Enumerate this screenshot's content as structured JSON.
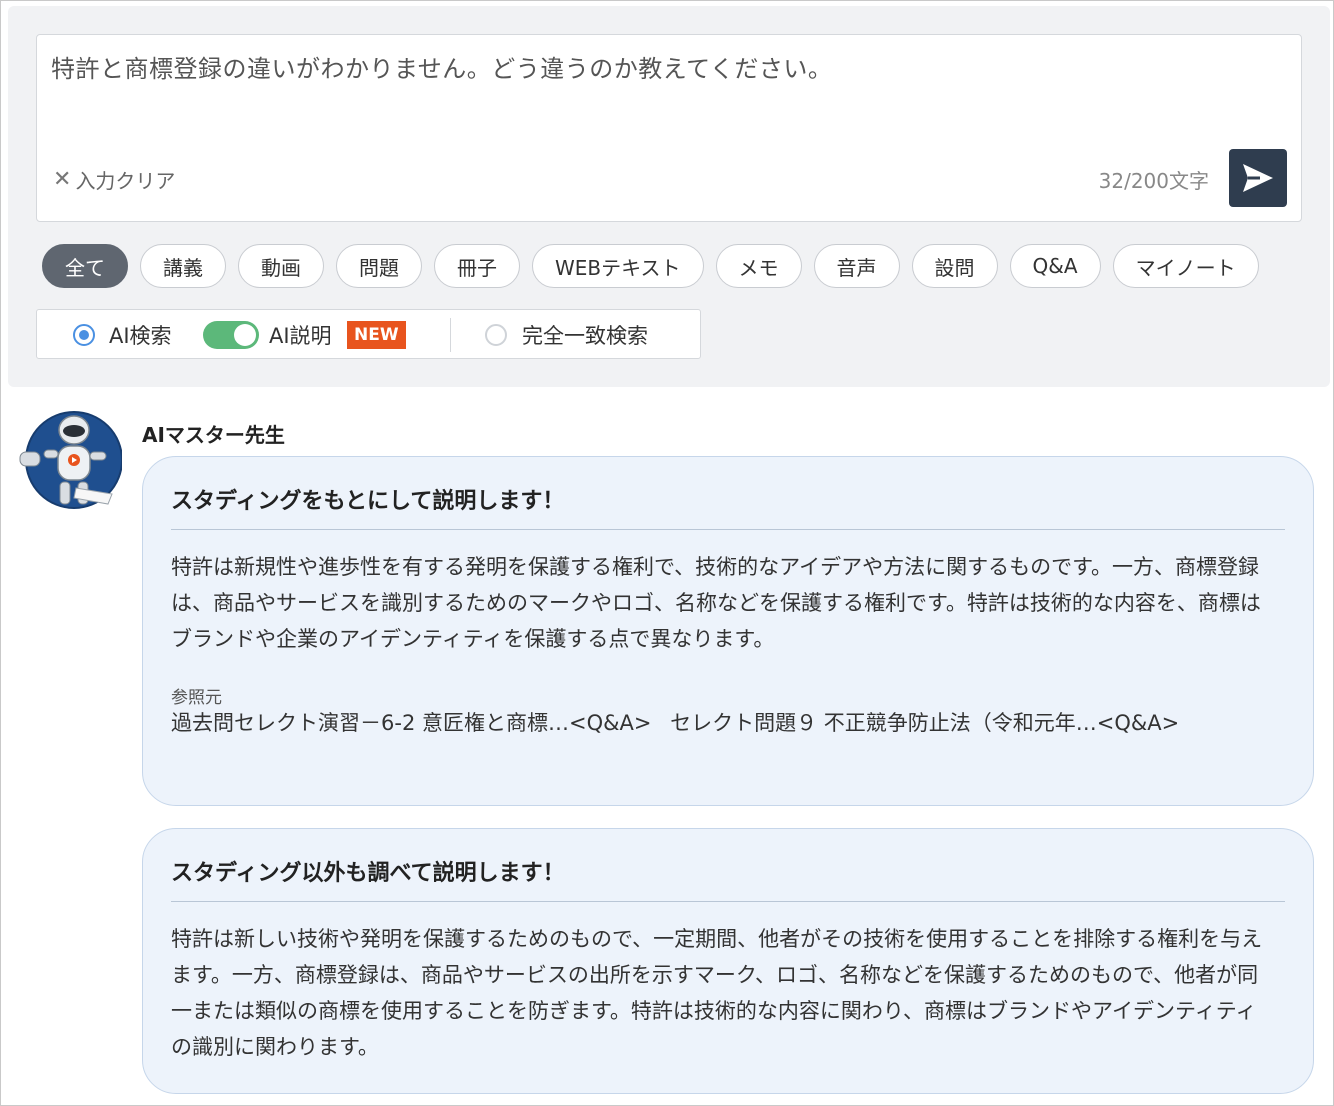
{
  "search": {
    "query": "特許と商標登録の違いがわかりません。どう違うのか教えてください。",
    "clear_label": "入力クリア",
    "char_count": "32/200文字"
  },
  "filters": [
    {
      "label": "全て",
      "active": true
    },
    {
      "label": "講義",
      "active": false
    },
    {
      "label": "動画",
      "active": false
    },
    {
      "label": "問題",
      "active": false
    },
    {
      "label": "冊子",
      "active": false
    },
    {
      "label": "WEBテキスト",
      "active": false
    },
    {
      "label": "メモ",
      "active": false
    },
    {
      "label": "音声",
      "active": false
    },
    {
      "label": "設問",
      "active": false
    },
    {
      "label": "Q&A",
      "active": false
    },
    {
      "label": "マイノート",
      "active": false
    }
  ],
  "mode": {
    "ai_search_label": "AI検索",
    "ai_search_selected": true,
    "ai_explain_label": "AI説明",
    "ai_explain_on": true,
    "new_badge": "NEW",
    "exact_label": "完全一致検索",
    "exact_selected": false
  },
  "answer": {
    "speaker": "AIマスター先生",
    "cards": [
      {
        "title": "スタディングをもとにして説明します！",
        "body": "特許は新規性や進歩性を有する発明を保護する権利で、技術的なアイデアや方法に関するものです。一方、商標登録は、商品やサービスを識別するためのマークやロゴ、名称などを保護する権利です。特許は技術的な内容を、商標はブランドや企業のアイデンティティを保護する点で異なります。",
        "ref_label": "参照元",
        "refs": [
          "過去問セレクト演習－6-2 意匠権と商標…<Q&A>",
          "セレクト問題９ 不正競争防止法（令和元年…<Q&A>"
        ]
      },
      {
        "title": "スタディング以外も調べて説明します！",
        "body": "特許は新しい技術や発明を保護するためのもので、一定期間、他者がその技術を使用することを排除する権利を与えます。一方、商標登録は、商品やサービスの出所を示すマーク、ロゴ、名称などを保護するためのもので、他者が同一または類似の商標を使用することを防ぎます。特許は技術的な内容に関わり、商標はブランドやアイデンティティの識別に関わります。"
      }
    ]
  },
  "colors": {
    "panel_bg": "#f1f2f4",
    "send_button": "#2f3d4f",
    "active_chip": "#5f6670",
    "radio_blue": "#4a90e2",
    "toggle_green": "#5cb87a",
    "new_badge": "#e8541e",
    "card_bg": "#edf3fb"
  },
  "icons": {
    "clear": "close-icon",
    "send": "paper-plane-icon",
    "avatar": "robot-avatar"
  }
}
